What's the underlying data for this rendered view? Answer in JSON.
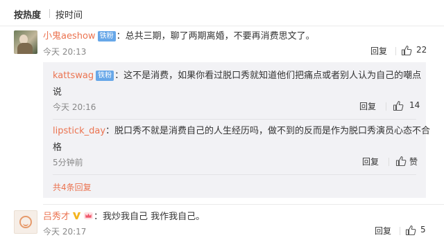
{
  "sort_tabs": {
    "hot": "按热度",
    "time": "按时间"
  },
  "comments": [
    {
      "username": "小鬼aeshow",
      "badge": "铁粉",
      "text": "：总共三期，聊了两期离婚，不要再消费思文了。",
      "time": "今天 20:13",
      "reply_label": "回复",
      "likes": "22",
      "replies": [
        {
          "username": "kattswag",
          "badge": "铁粉",
          "text_line1": "：这不是消费，如果你看过脱口秀就知道他们把痛点或者别人认为自己的嘲点",
          "text_line2": "说",
          "time": "今天 20:16",
          "reply_label": "回复",
          "likes": "14"
        },
        {
          "username": "lipstick_day",
          "text_line1": "：脱口秀不就是消费自己的人生经历吗，做不到的反而是作为脱口秀演员心态不合",
          "text_line2": "格",
          "time": "5分钟前",
          "reply_label": "回复",
          "likes": "赞"
        }
      ],
      "more_replies": "共4条回复"
    },
    {
      "username": "吕秀才",
      "text": "：我炒我自己 我作我自己。",
      "time": "今天 20:17",
      "reply_label": "回复",
      "likes": "5"
    }
  ],
  "icons": {
    "like": "thumbs-up-icon",
    "avatar1": "user-photo",
    "avatar2": "default-face-avatar",
    "badge_v": "verified-v-icon",
    "badge_vip": "vip-crown-icon"
  },
  "colors": {
    "username": "#eb7350",
    "fan_badge": "#67a7e8",
    "reply_bg": "#f2f2f5",
    "time": "#888888"
  }
}
